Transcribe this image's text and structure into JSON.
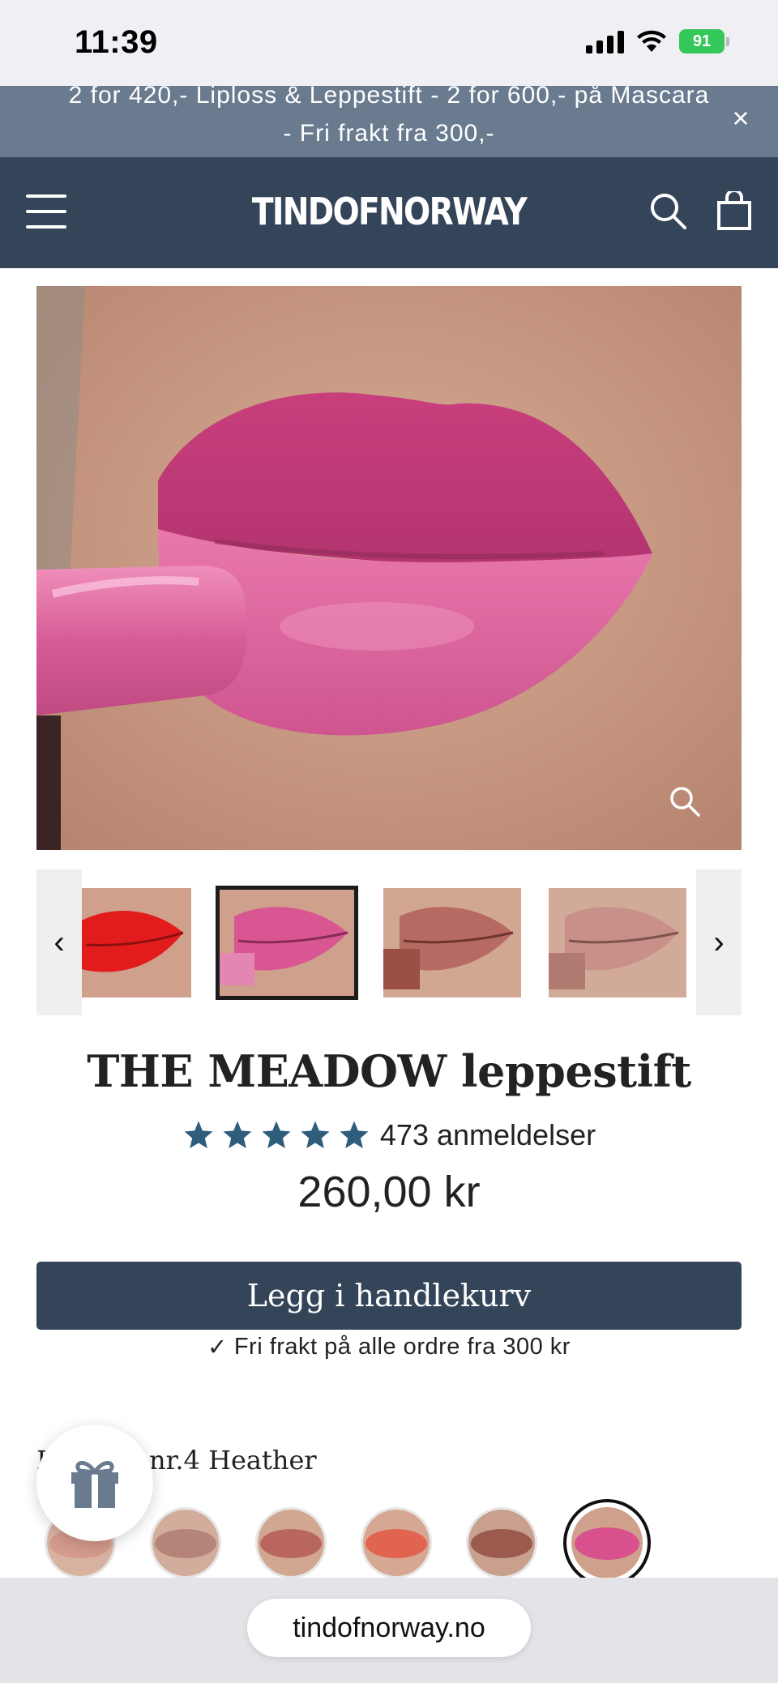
{
  "status_bar": {
    "time": "11:39",
    "battery": "91"
  },
  "announcement": {
    "text": "2 for 420,- Liploss & Leppestift - 2 for 600,- på Mascara - Fri frakt fra 300,-",
    "close_icon": "×"
  },
  "header": {
    "logo": "TINDOFNORWAY",
    "icons": [
      "menu-icon",
      "search-icon",
      "cart-icon"
    ]
  },
  "gallery": {
    "prev_icon": "‹",
    "next_icon": "›",
    "thumbnails": [
      {
        "color": "#e61e1e"
      },
      {
        "color": "#d85792"
      },
      {
        "color": "#b76a63"
      },
      {
        "color": "#c89089"
      }
    ],
    "active_thumbnail": 1
  },
  "product": {
    "title": "THE MEADOW leppestift",
    "rating_stars": 5,
    "review_count": "473 anmeldelser",
    "price": "260,00 kr",
    "add_to_cart_label": "Legg i handlekurv",
    "shipping_check_icon": "✓",
    "shipping_note": "Fri frakt på alle ordre fra 300 kr"
  },
  "variant": {
    "label": "Lipstick nr.4 Heather",
    "swatches": [
      {
        "color": "#d49a8c"
      },
      {
        "color": "#b58478"
      },
      {
        "color": "#b8665e"
      },
      {
        "color": "#e0644f"
      },
      {
        "color": "#9a5a4e"
      },
      {
        "color": "#d8508c"
      }
    ],
    "active_swatch": 5
  },
  "colors": {
    "brand": "#354559",
    "announcement": "#6a7b90",
    "star": "#2f5d7c"
  },
  "browser": {
    "url": "tindofnorway.no"
  }
}
